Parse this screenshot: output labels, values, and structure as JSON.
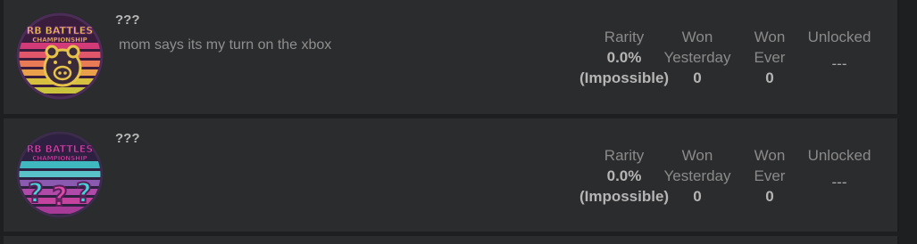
{
  "badges": [
    {
      "icon_name": "rb-battles-pig-badge",
      "icon_text_line1": "RB BATTLES",
      "icon_text_line2": "CHAMPIONSHIP",
      "name": "???",
      "description": "mom says its my turn on the xbox",
      "rarity_label": "Rarity",
      "rarity_value": "0.0%",
      "rarity_note": "(Impossible)",
      "won_yesterday_label_1": "Won",
      "won_yesterday_label_2": "Yesterday",
      "won_yesterday_value": "0",
      "won_ever_label_1": "Won",
      "won_ever_label_2": "Ever",
      "won_ever_value": "0",
      "unlocked_label": "Unlocked",
      "unlocked_value": "---"
    },
    {
      "icon_name": "rb-battles-question-badge",
      "icon_text_line1": "RB BATTLES",
      "icon_text_line2": "CHAMPIONSHIP",
      "name": "???",
      "description": "",
      "rarity_label": "Rarity",
      "rarity_value": "0.0%",
      "rarity_note": "(Impossible)",
      "won_yesterday_label_1": "Won",
      "won_yesterday_label_2": "Yesterday",
      "won_yesterday_value": "0",
      "won_ever_label_1": "Won",
      "won_ever_label_2": "Ever",
      "won_ever_value": "0",
      "unlocked_label": "Unlocked",
      "unlocked_value": "---"
    }
  ],
  "colors": {
    "page_bg": "#1e1f21",
    "card_bg": "#2b2c2e",
    "label_gray": "#8a8a8a",
    "value_gray": "#b5b5b5"
  }
}
